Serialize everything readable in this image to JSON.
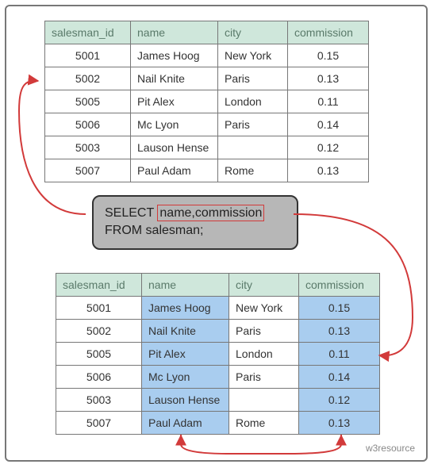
{
  "columns": {
    "c0": "salesman_id",
    "c1": "name",
    "c2": "city",
    "c3": "commission"
  },
  "rows": [
    {
      "id": "5001",
      "name": "James Hoog",
      "city": "New York",
      "comm": "0.15"
    },
    {
      "id": "5002",
      "name": "Nail Knite",
      "city": "Paris",
      "comm": "0.13"
    },
    {
      "id": "5005",
      "name": "Pit Alex",
      "city": "London",
      "comm": "0.11"
    },
    {
      "id": "5006",
      "name": "Mc Lyon",
      "city": "Paris",
      "comm": "0.14"
    },
    {
      "id": "5003",
      "name": "Lauson Hense",
      "city": "",
      "comm": "0.12"
    },
    {
      "id": "5007",
      "name": "Paul Adam",
      "city": "Rome",
      "comm": "0.13"
    }
  ],
  "sql": {
    "select_kw": "SELECT ",
    "cols": "name,commission",
    "from_line": "FROM salesman;"
  },
  "watermark": "w3resource"
}
